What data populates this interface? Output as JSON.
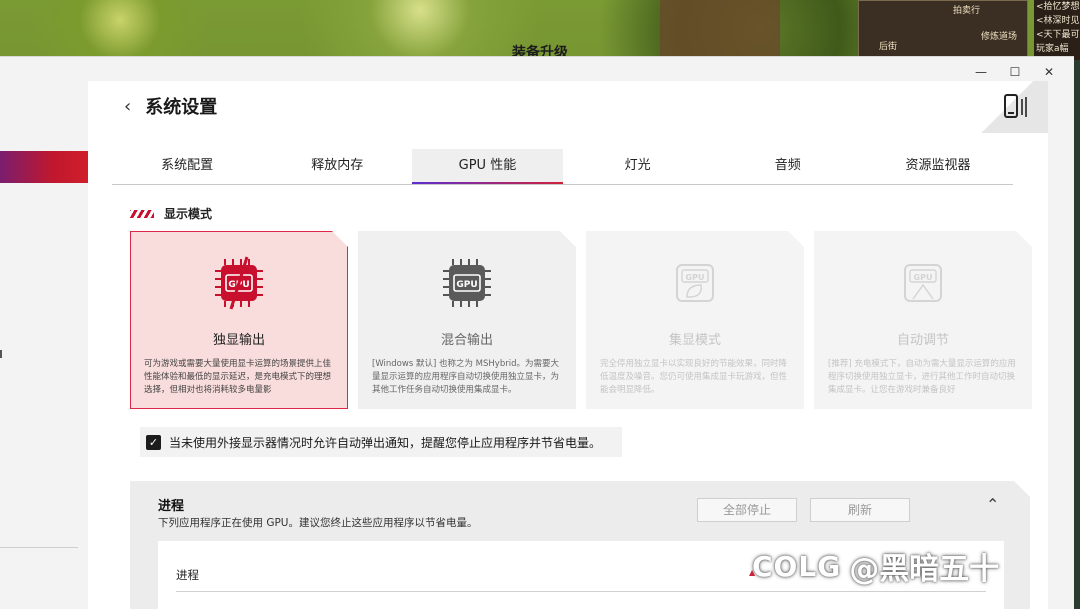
{
  "game": {
    "title": "装备升级",
    "minimap": [
      "拍卖行",
      "后街",
      "修炼道场"
    ],
    "chat": [
      "<拾忆梦想",
      "<林深时见",
      "<天下最可",
      "玩家a幅"
    ]
  },
  "window": {
    "controls": {
      "minimize": "—",
      "maximize": "☐",
      "close": "✕"
    }
  },
  "header": {
    "title": "系统设置"
  },
  "tabs": [
    {
      "label": "系统配置",
      "active": false
    },
    {
      "label": "释放内存",
      "active": false
    },
    {
      "label": "GPU 性能",
      "active": true
    },
    {
      "label": "灯光",
      "active": false
    },
    {
      "label": "音频",
      "active": false
    },
    {
      "label": "资源监视器",
      "active": false
    }
  ],
  "display_mode": {
    "title": "显示模式",
    "cards": [
      {
        "title": "独显输出",
        "icon_label": "GPU",
        "state": "selected",
        "desc": "可为游戏或需要大量使用显卡运算的场景提供上佳性能体验和最低的显示延迟，是充电模式下的理想选择，但相对也将消耗较多电量影"
      },
      {
        "title": "混合输出",
        "icon_label": "GPU",
        "state": "normal",
        "desc": "[Windows 默认] 也称之为 MSHybrid。为需要大量显示运算的应用程序自动切换使用独立显卡，为其他工作任务自动切换使用集成显卡。"
      },
      {
        "title": "集显模式",
        "icon_label": "GPU",
        "state": "disabled",
        "desc": "完全停用独立显卡以实现良好的节能效果，同时降低温度及噪音。您仍可使用集成显卡玩游戏，但性能会明显降低。"
      },
      {
        "title": "自动调节",
        "icon_label": "GPU",
        "state": "disabled",
        "desc": "[推荐] 充电模式下，自动为需大量显示运算的应用程序切换使用独立显卡，进行其他工作时自动切换集成显卡。让您在游戏时兼备良好"
      }
    ]
  },
  "notify": {
    "checked": true,
    "label": "当未使用外接显示器情况时允许自动弹出通知，提醒您停止应用程序并节省电量。"
  },
  "process": {
    "title": "进程",
    "subtitle": "下列应用程序正在使用 GPU。建议您终止这些应用程序以节省电量。",
    "stop_all": "全部停止",
    "refresh": "刷新",
    "column": "进程"
  },
  "watermark": {
    "logo": "COLG",
    "text": "@黑暗五十"
  }
}
